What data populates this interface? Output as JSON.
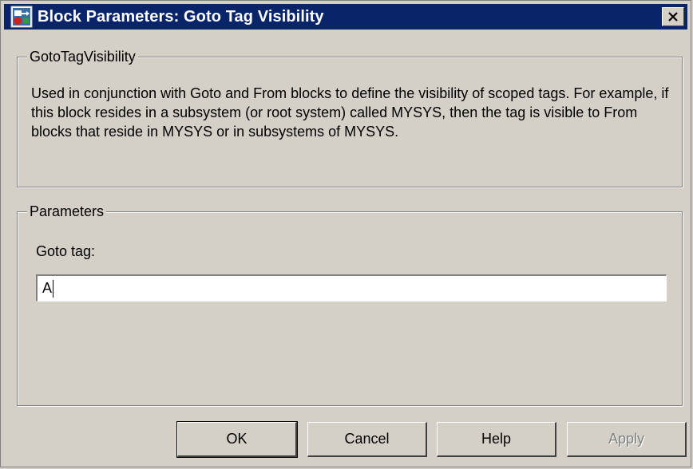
{
  "window": {
    "title": "Block Parameters: Goto Tag Visibility",
    "title_bar_color": "#0a246a",
    "icon": "simulink-block-icon",
    "close_icon": "close-icon"
  },
  "description_group": {
    "legend": "GotoTagVisibility",
    "text": "Used in conjunction with Goto and From blocks to define the visibility of scoped tags.  For example, if this block resides in a subsystem (or root system) called MYSYS, then the tag is visible to From blocks that reside in MYSYS or in subsystems of MYSYS."
  },
  "parameters_group": {
    "legend": "Parameters",
    "goto_tag_label": "Goto tag:",
    "goto_tag_value": "A"
  },
  "buttons": {
    "ok": "OK",
    "cancel": "Cancel",
    "help": "Help",
    "apply": "Apply"
  }
}
